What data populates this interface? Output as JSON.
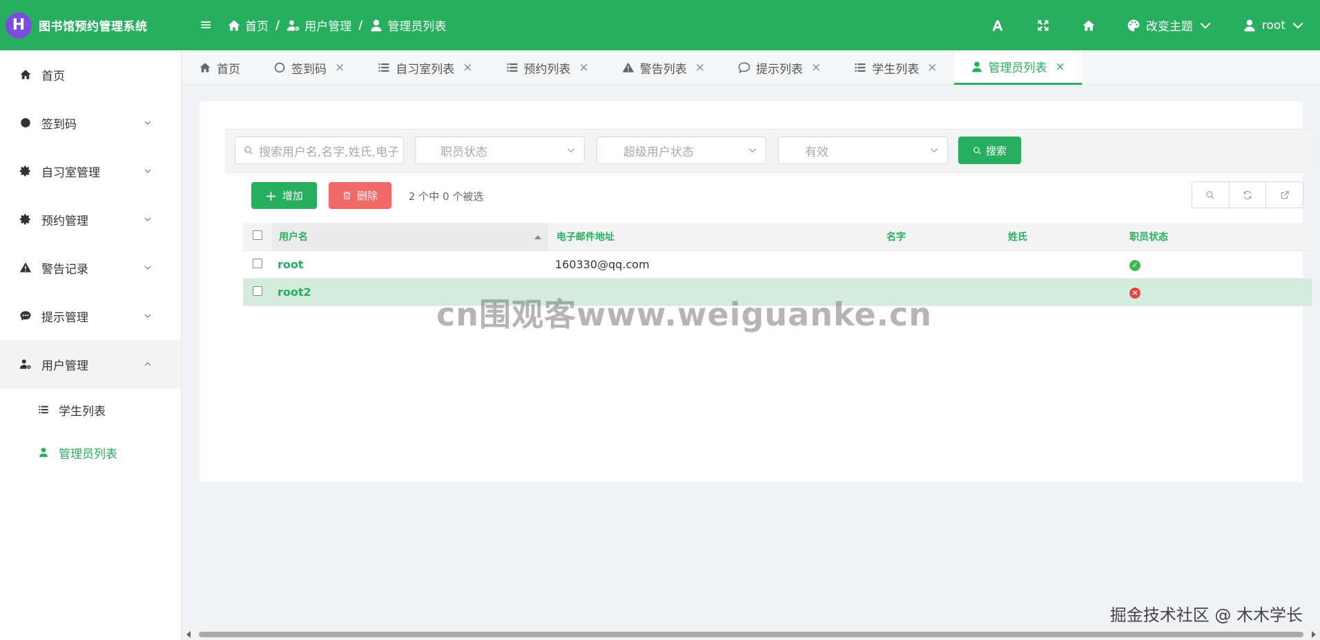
{
  "app": {
    "logo_letter": "H",
    "title": "图书馆预约管理系统"
  },
  "breadcrumb": [
    "首页",
    "用户管理",
    "管理员列表"
  ],
  "header": {
    "theme_label": "改变主题",
    "user_label": "root"
  },
  "sidebar": {
    "items": [
      {
        "label": "首页"
      },
      {
        "label": "签到码"
      },
      {
        "label": "自习室管理"
      },
      {
        "label": "预约管理"
      },
      {
        "label": "警告记录"
      },
      {
        "label": "提示管理"
      },
      {
        "label": "用户管理"
      }
    ],
    "sub_items": [
      {
        "label": "学生列表"
      },
      {
        "label": "管理员列表"
      }
    ]
  },
  "tabs": [
    {
      "label": "首页"
    },
    {
      "label": "签到码",
      "close": "×"
    },
    {
      "label": "自习室列表",
      "close": "×"
    },
    {
      "label": "预约列表",
      "close": "×"
    },
    {
      "label": "警告列表",
      "close": "×"
    },
    {
      "label": "提示列表",
      "close": "×"
    },
    {
      "label": "学生列表",
      "close": "×"
    },
    {
      "label": "管理员列表",
      "close": "×"
    }
  ],
  "filters": {
    "search_placeholder": "搜索用户名,名字,姓氏,电子",
    "staff_status": "职员状态",
    "superuser_status": "超级用户状态",
    "active": "有效",
    "search_button": "搜索"
  },
  "actions": {
    "add": "增加",
    "delete": "删除",
    "selection_count": "2 个中 0 个被选"
  },
  "table": {
    "headers": [
      "用户名",
      "电子邮件地址",
      "名字",
      "姓氏",
      "职员状态"
    ],
    "rows": [
      {
        "username": "root",
        "email": "160330@qq.com",
        "first_name": "",
        "last_name": "",
        "staff": true
      },
      {
        "username": "root2",
        "email": "",
        "first_name": "",
        "last_name": "",
        "staff": false
      }
    ]
  },
  "watermark": "cn围观客www.weiguanke.cn",
  "footer_mark": "掘金技术社区 @ 木木学长",
  "colors": {
    "brand": "#27ae5f",
    "danger": "#f06a6a",
    "logo": "#7b4ddf"
  }
}
